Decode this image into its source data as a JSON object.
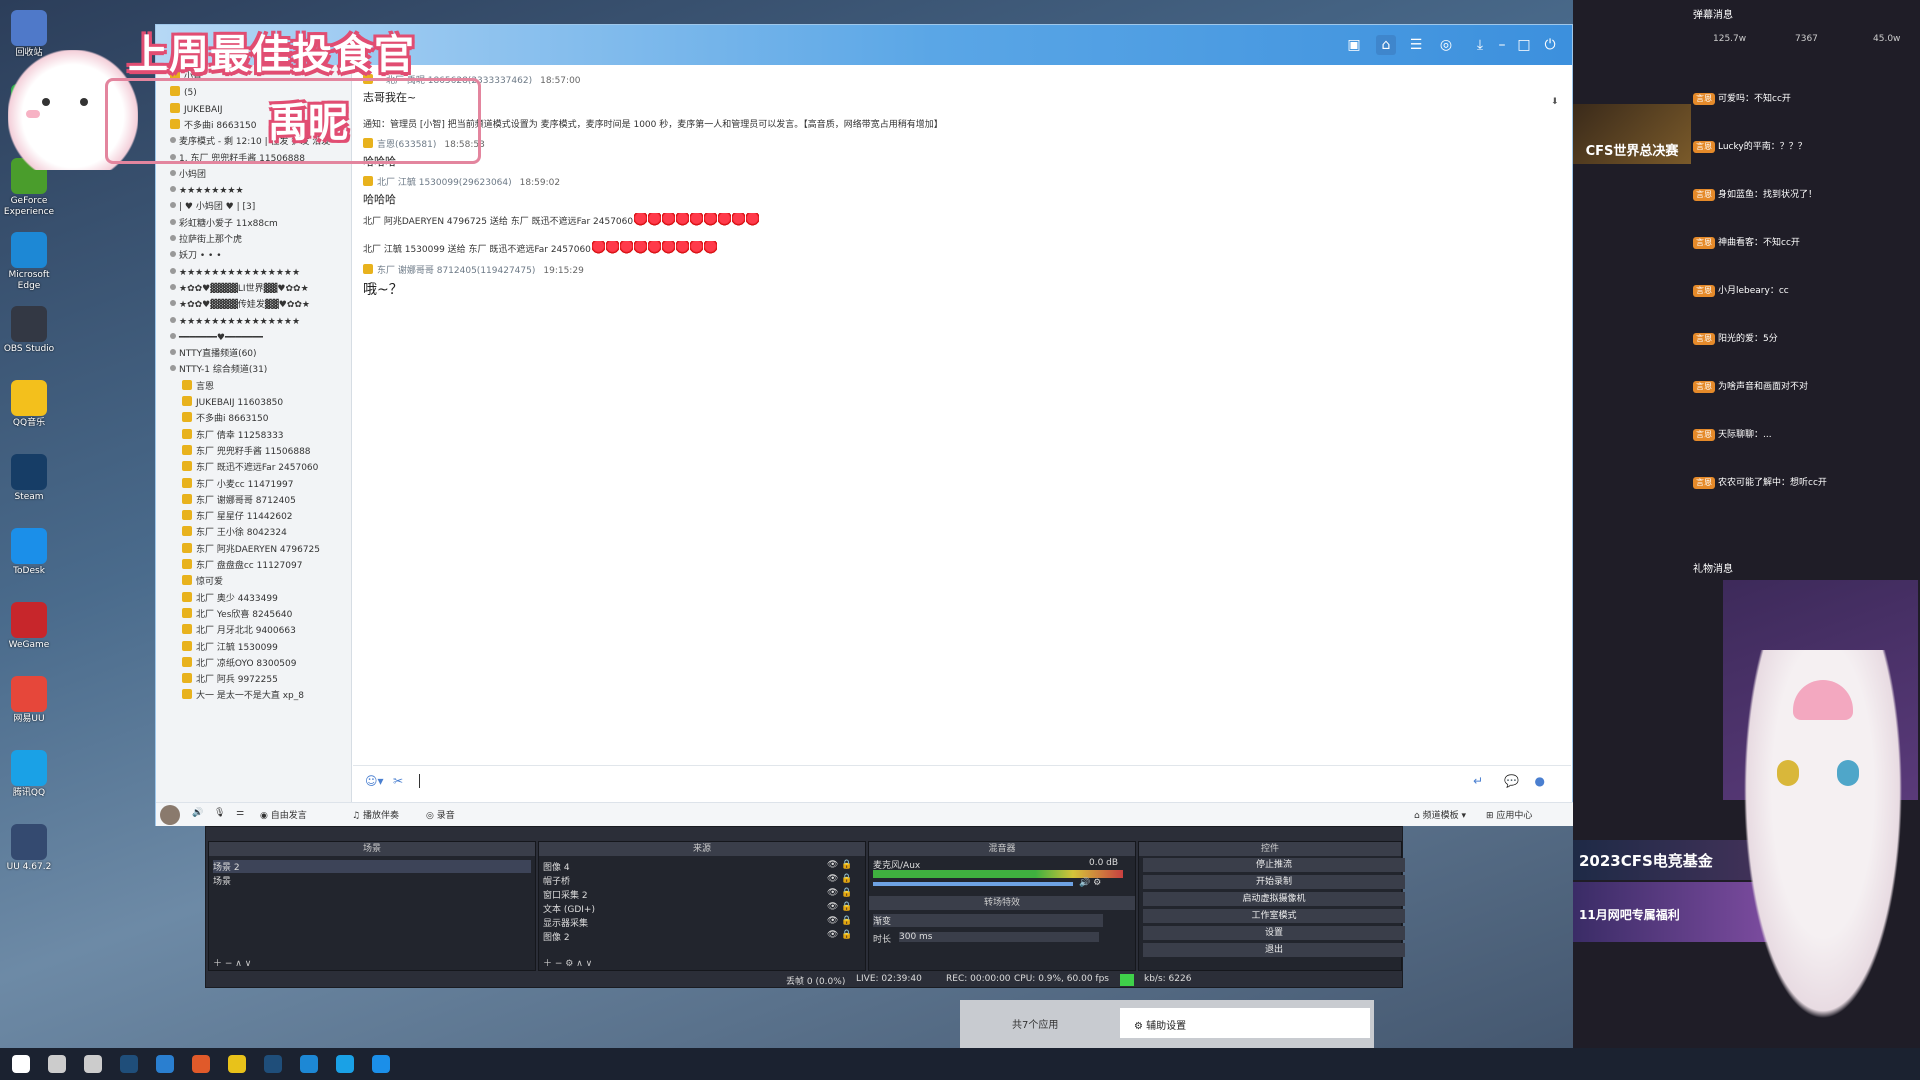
{
  "overlay": {
    "title": "上周最佳投食官",
    "name": "禹昵"
  },
  "desktop_icons": [
    {
      "label": "回收站",
      "color": "#4f79c9"
    },
    {
      "label": "WeChat",
      "color": "#2fb34a"
    },
    {
      "label": "GeForce Experience",
      "color": "#4a9d2c"
    },
    {
      "label": "Microsoft Edge",
      "color": "#1d88d5"
    },
    {
      "label": "OBS Studio",
      "color": "#333844"
    },
    {
      "label": "QQ音乐",
      "color": "#f3c01c"
    },
    {
      "label": "Steam",
      "color": "#163d66"
    },
    {
      "label": "ToDesk",
      "color": "#1b8fe9"
    },
    {
      "label": "WeGame",
      "color": "#c7262b"
    },
    {
      "label": "网易UU",
      "color": "#e6473a"
    },
    {
      "label": "腾讯QQ",
      "color": "#1aa1e6"
    },
    {
      "label": "UU 4.67.2",
      "color": "#344a70"
    }
  ],
  "chat": {
    "messages": [
      {
        "type": "meta",
        "name": "一北厂 禹昵 1865628(2333337462)",
        "time": "18:57:00"
      },
      {
        "type": "text",
        "text": "志哥我在~"
      },
      {
        "type": "notice",
        "text": "通知：管理员 [小智] 把当前频道模式设置为 麦序模式，麦序时间是 1000 秒，麦序第一人和管理员可以发言。【高音质，网络带宽占用稍有增加】"
      },
      {
        "type": "meta",
        "name": "言恩(633581)",
        "time": "18:58:53"
      },
      {
        "type": "text",
        "text": "哈哈哈"
      },
      {
        "type": "meta",
        "name": "北厂 江毓 1530099(29623064)",
        "time": "18:59:02"
      },
      {
        "type": "text",
        "text": "哈哈哈"
      },
      {
        "type": "gift",
        "text": "北厂 阿兆DAERYEN 4796725 送给 东厂 既迅不遮远Far 2457060",
        "count": 9
      },
      {
        "type": "gift",
        "text": "北厂 江毓 1530099 送给 东厂 既迅不遮远Far 2457060",
        "count": 9
      },
      {
        "type": "meta",
        "name": "东厂 谢娜哥哥 8712405(119427475)",
        "time": "19:15:29"
      },
      {
        "type": "text-large",
        "text": "哦~？"
      }
    ],
    "left_tree": [
      "小智",
      "(5)",
      "JUKEBAIJ",
      "不多曲i 8663150",
      "麦序模式 - 剩 12:10   |   往发  扩发  沿发",
      "1.  东厂 兜兜籽手酱 11506888",
      "小妈团",
      "★★★★★★★★",
      "| ♥ 小妈团 ♥ | [3]",
      "彩虹糖小爱子 11x88cm",
      "拉萨街上那个虎",
      "妖刀 • • •",
      "★★★★★★★★★★★★★★★",
      "★✿✿♥▓▓▓▓LI世界▓▓♥✿✿★",
      "★✿✿♥▓▓▓▓传娃发▓▓♥✿✿★",
      "★★★★★★★★★★★★★★★",
      "━━━━━━━♥━━━━━━━",
      "NTTY直播频道(60)",
      "NTTY-1 综合频道(31)",
      "言恩",
      "JUKEBAIJ 11603850",
      "不多曲i 8663150",
      "东厂 倩幸 11258333",
      "东厂 兜兜籽手酱 11506888",
      "东厂 既迅不遮远Far 2457060",
      "东厂 小麦cc 11471997",
      "东厂 谢娜哥哥 8712405",
      "东厂 星星仔 11442602",
      "东厂 王小徐 8042324",
      "东厂 阿兆DAERYEN 4796725",
      "东厂 盘盘盘cc 11127097",
      "惊可爱",
      "北厂 奥少 4433499",
      "北厂 Yes欣喜 8245640",
      "北厂 月牙北北 9400663",
      "北厂 江毓 1530099",
      "北厂 凉纸OYO 8300509",
      "北厂 阿兵 9972255",
      "大一 是太一不是大直 xp_8"
    ],
    "bottom_bar": {
      "free_talk": "自由发言",
      "music": "播放伴奏",
      "record": "录音",
      "template": "频道模板",
      "apps": "应用中心"
    }
  },
  "obs": {
    "scenes_title": "场景",
    "scenes": [
      "场景 2",
      "场景"
    ],
    "sources_title": "来源",
    "sources": [
      "图像 4",
      "帽子桥",
      "窗口采集 2",
      "文本 (GDI+)",
      "显示器采集",
      "图像 2"
    ],
    "mixer_title": "混音器",
    "mixer_channel": "麦克风/Aux",
    "mixer_db": "0.0 dB",
    "transition_title": "转场特效",
    "transition": "渐变",
    "duration_label": "时长",
    "duration": "300 ms",
    "controls_title": "控件",
    "controls": [
      "停止推流",
      "开始录制",
      "启动虚拟摄像机",
      "工作室模式",
      "设置",
      "退出"
    ],
    "status": {
      "dropped": "丢帧 0 (0.0%)",
      "live": "LIVE: 02:39:40",
      "rec": "REC: 00:00:00",
      "cpu": "CPU: 0.9%, 60.00 fps",
      "bitrate": "kb/s: 6226"
    }
  },
  "live": {
    "title": "弹幕消息",
    "stats": [
      "125.7w",
      "7367",
      "45.0w"
    ],
    "banner": "CFS世界总决赛",
    "danmaku": [
      {
        "badge": "言恩",
        "text": "可爱吗：不知cc开"
      },
      {
        "badge": "言恩",
        "text": "Lucky的平南：？？？"
      },
      {
        "badge": "言恩",
        "text": "身如蓝鱼：找到状况了！"
      },
      {
        "badge": "言恩",
        "text": "神曲看客：不知cc开"
      },
      {
        "badge": "言恩",
        "text": "小月lebeary：cc"
      },
      {
        "badge": "言恩",
        "text": "阳光的爱：5分"
      },
      {
        "badge": "言恩",
        "text": "为啥声音和画面对不对"
      },
      {
        "badge": "言恩",
        "text": "天际聊聊：..."
      },
      {
        "badge": "言恩",
        "text": "农农可能了解中：想听cc开"
      }
    ],
    "gift_title": "礼物消息",
    "promo": "2023CFS电竞基金",
    "promo2": "11月网吧专属福利",
    "settings_label": "辅助设置",
    "apps_count": "共7个应用"
  },
  "taskbar": {
    "apps": [
      "start",
      "search",
      "taskview",
      "steam",
      "kugou",
      "obs",
      "yy",
      "steam2",
      "edge",
      "qq",
      "todesk"
    ]
  }
}
